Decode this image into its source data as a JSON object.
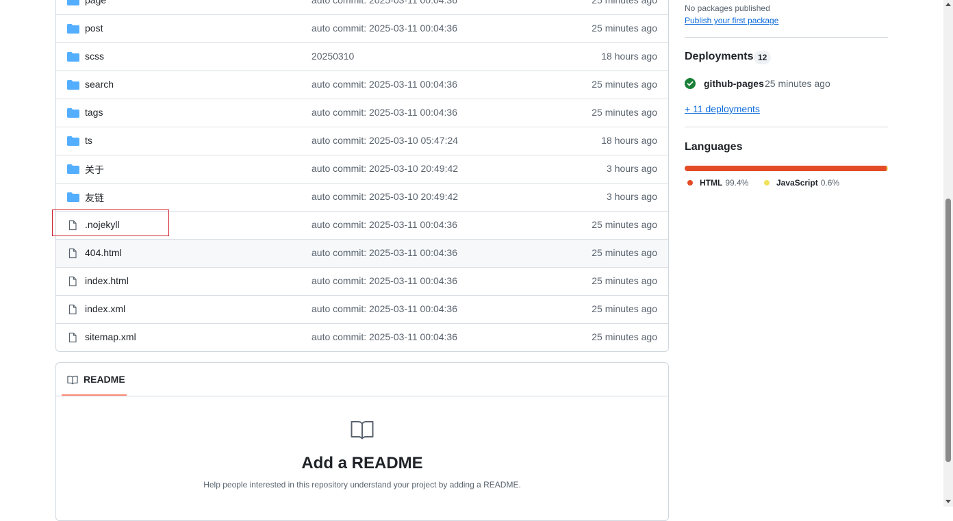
{
  "files": [
    {
      "name": "page",
      "type": "dir",
      "message": "auto commit: 2025-03-11 00:04:36",
      "age": "25 minutes ago"
    },
    {
      "name": "post",
      "type": "dir",
      "message": "auto commit: 2025-03-11 00:04:36",
      "age": "25 minutes ago"
    },
    {
      "name": "scss",
      "type": "dir",
      "message": "20250310",
      "age": "18 hours ago"
    },
    {
      "name": "search",
      "type": "dir",
      "message": "auto commit: 2025-03-11 00:04:36",
      "age": "25 minutes ago"
    },
    {
      "name": "tags",
      "type": "dir",
      "message": "auto commit: 2025-03-11 00:04:36",
      "age": "25 minutes ago"
    },
    {
      "name": "ts",
      "type": "dir",
      "message": "auto commit: 2025-03-10 05:47:24",
      "age": "18 hours ago"
    },
    {
      "name": "关于",
      "type": "dir",
      "message": "auto commit: 2025-03-10 20:49:42",
      "age": "3 hours ago"
    },
    {
      "name": "友链",
      "type": "dir",
      "message": "auto commit: 2025-03-10 20:49:42",
      "age": "3 hours ago"
    },
    {
      "name": ".nojekyll",
      "type": "file",
      "message": "auto commit: 2025-03-11 00:04:36",
      "age": "25 minutes ago"
    },
    {
      "name": "404.html",
      "type": "file",
      "message": "auto commit: 2025-03-11 00:04:36",
      "age": "25 minutes ago"
    },
    {
      "name": "index.html",
      "type": "file",
      "message": "auto commit: 2025-03-11 00:04:36",
      "age": "25 minutes ago"
    },
    {
      "name": "index.xml",
      "type": "file",
      "message": "auto commit: 2025-03-11 00:04:36",
      "age": "25 minutes ago"
    },
    {
      "name": "sitemap.xml",
      "type": "file",
      "message": "auto commit: 2025-03-11 00:04:36",
      "age": "25 minutes ago"
    }
  ],
  "readme": {
    "tab_label": "README",
    "title": "Add a README",
    "description": "Help people interested in this repository understand your project by adding a README."
  },
  "sidebar": {
    "packages": {
      "none_text": "No packages published",
      "publish_link": "Publish your first package"
    },
    "deployments": {
      "title": "Deployments",
      "count": "12",
      "environment": "github-pages",
      "time": "25 minutes ago",
      "more_link": "+ 11 deployments"
    },
    "languages": {
      "title": "Languages",
      "items": [
        {
          "name": "HTML",
          "percent": "99.4%",
          "value": 99.4,
          "color": "#e34c26"
        },
        {
          "name": "JavaScript",
          "percent": "0.6%",
          "value": 0.6,
          "color": "#f1e05a"
        }
      ]
    }
  },
  "icons": {
    "folder": "folder-icon",
    "file": "file-icon",
    "book": "book-icon",
    "check": "check-circle-icon"
  },
  "colors": {
    "folder": "#54aeff",
    "link": "#0969da",
    "success": "#1a7f37",
    "highlight": "#cf222e",
    "tab_underline": "#fd8c73"
  }
}
